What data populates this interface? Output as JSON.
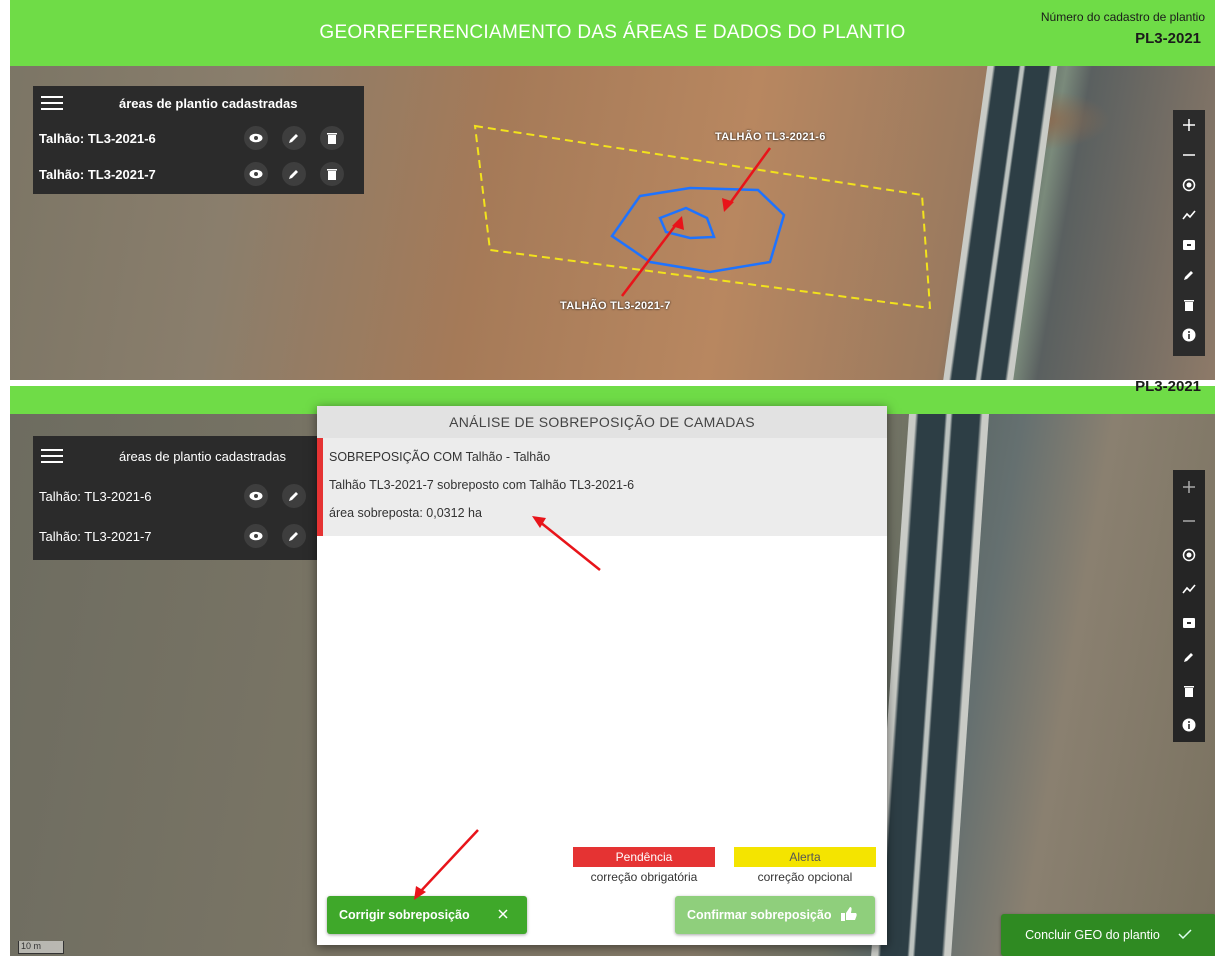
{
  "header": {
    "title": "GEORREFERENCIAMENTO DAS ÁREAS E DADOS DO PLANTIO",
    "cadastro_label": "Número do cadastro de plantio",
    "cadastro_value": "PL3-2021"
  },
  "bottom_header": {
    "cadastro_value": "PL3-2021"
  },
  "areas_panel": {
    "title": "áreas de plantio cadastradas",
    "items": [
      {
        "label": "Talhão: TL3-2021-6"
      },
      {
        "label": "Talhão: TL3-2021-7"
      }
    ]
  },
  "map_overlay": {
    "label_6": "TALHÃO TL3-2021-6",
    "label_7": "TALHÃO TL3-2021-7",
    "scale": "10 m"
  },
  "map_tools": [
    "plus-icon",
    "minus-icon",
    "locate-icon",
    "line-icon",
    "archive-icon",
    "pencil-icon",
    "trash-icon",
    "info-icon"
  ],
  "dialog": {
    "title": "ANÁLISE DE SOBREPOSIÇÃO DE CAMADAS",
    "issue_title": "SOBREPOSIÇÃO COM Talhão - Talhão",
    "issue_detail": "Talhão TL3-2021-7 sobreposto com Talhão TL3-2021-6",
    "issue_area": "área sobreposta: 0,0312 ha",
    "legend": {
      "pendencia": "Pendência",
      "pendencia_desc": "correção obrigatória",
      "alerta": "Alerta",
      "alerta_desc": "correção opcional"
    },
    "fix_button": "Corrigir sobreposição",
    "confirm_button": "Confirmar sobreposição"
  },
  "conclude_button": "Concluir GEO do plantio",
  "colors": {
    "header_green": "#6fdc47",
    "panel_dark": "#2b2b2b",
    "pendencia_red": "#e53333",
    "alerta_yellow": "#f4e400",
    "button_green": "#3fa82a",
    "confirm_green": "#8fcf7c",
    "polygon_blue": "#1e73ff",
    "boundary_yellow": "#f2e21c",
    "arrow_red": "#e8141a"
  }
}
